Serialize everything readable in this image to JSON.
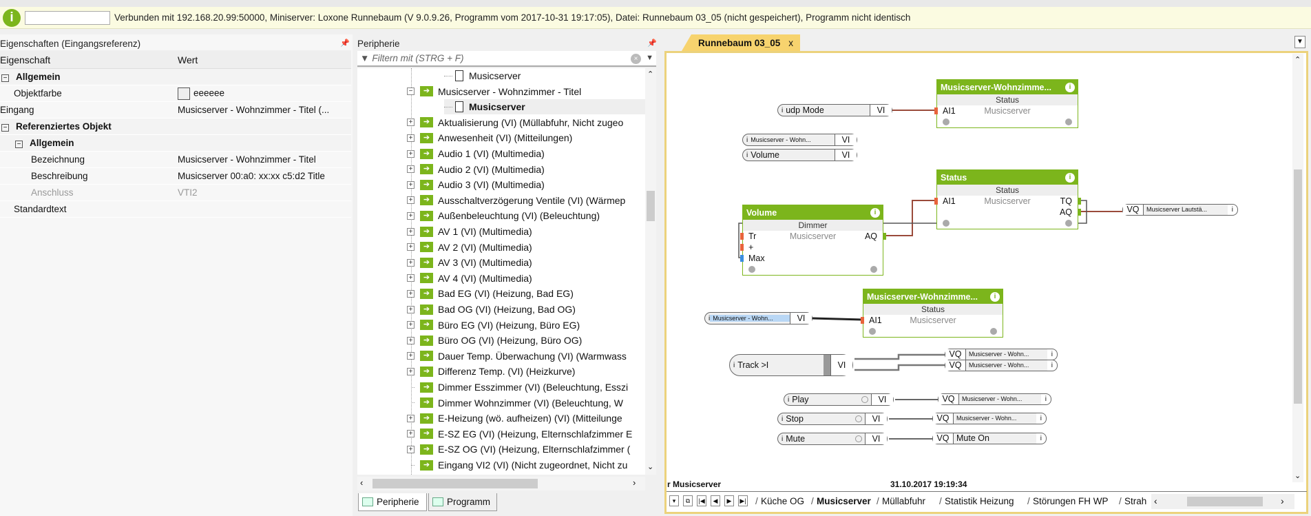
{
  "infobar": {
    "text": "Verbunden mit 192.168.20.99:50000, Miniserver: Loxone Runnebaum (V 9.0.9.26, Programm vom 2017-10-31 19:17:05), Datei: Runnebaum 03_05 (nicht gespeichert), Programm nicht identisch"
  },
  "properties": {
    "title": "Eigenschaften (Eingangsreferenz)",
    "col_property": "Eigenschaft",
    "col_value": "Wert",
    "rows": [
      {
        "label": "Allgemein",
        "value": "",
        "group": true,
        "level": 0
      },
      {
        "label": "Objektfarbe",
        "value": "eeeeee",
        "level": 1,
        "swatch": "#eeeeee"
      },
      {
        "label": "Eingang",
        "value": "Musicserver - Wohnzimmer - Titel (...",
        "level": 0
      },
      {
        "label": "Referenziertes Objekt",
        "value": "",
        "group": true,
        "level": 0
      },
      {
        "label": "Allgemein",
        "value": "",
        "group": true,
        "level": 1
      },
      {
        "label": "Bezeichnung",
        "value": "Musicserver - Wohnzimmer - Titel",
        "level": 2
      },
      {
        "label": "Beschreibung",
        "value": "Musicserver 00:a0: xx:xx c5:d2 Title",
        "level": 2
      },
      {
        "label": "Anschluss",
        "value": "VTI2",
        "level": 2,
        "dim": true
      },
      {
        "label": "Standardtext",
        "value": "",
        "level": 1
      }
    ]
  },
  "periphery": {
    "title": "Peripherie",
    "filter_placeholder": "Filtern mit (STRG + F)",
    "items": [
      {
        "label": "Musicserver",
        "kind": "doc"
      },
      {
        "label": "Musicserver - Wohnzimmer - Titel",
        "kind": "expanded"
      },
      {
        "label": "Musicserver",
        "kind": "doc",
        "selected": true
      },
      {
        "label": "Aktualisierung (VI) (Müllabfuhr, Nicht zugeo",
        "kind": "plus"
      },
      {
        "label": "Anwesenheit (VI) (Mitteilungen)",
        "kind": "plus"
      },
      {
        "label": "Audio 1 (VI) (Multimedia)",
        "kind": "plus"
      },
      {
        "label": "Audio 2 (VI) (Multimedia)",
        "kind": "plus"
      },
      {
        "label": "Audio 3 (VI) (Multimedia)",
        "kind": "plus"
      },
      {
        "label": "Ausschaltverzögerung Ventile (VI) (Wärmep",
        "kind": "plus"
      },
      {
        "label": "Außenbeleuchtung (VI) (Beleuchtung)",
        "kind": "plus"
      },
      {
        "label": "AV 1 (VI) (Multimedia)",
        "kind": "plus"
      },
      {
        "label": "AV 2 (VI) (Multimedia)",
        "kind": "plus"
      },
      {
        "label": "AV 3 (VI) (Multimedia)",
        "kind": "plus"
      },
      {
        "label": "AV 4 (VI) (Multimedia)",
        "kind": "plus"
      },
      {
        "label": "Bad EG (VI) (Heizung, Bad EG)",
        "kind": "plus"
      },
      {
        "label": "Bad OG (VI) (Heizung, Bad OG)",
        "kind": "plus"
      },
      {
        "label": "Büro EG (VI) (Heizung, Büro EG)",
        "kind": "plus"
      },
      {
        "label": "Büro OG (VI) (Heizung, Büro OG)",
        "kind": "plus"
      },
      {
        "label": "Dauer Temp. Überwachung (VI) (Warmwass",
        "kind": "plus"
      },
      {
        "label": "Differenz Temp. (VI) (Heizkurve)",
        "kind": "plus"
      },
      {
        "label": "Dimmer Esszimmer (VI) (Beleuchtung, Esszi",
        "kind": "leaf"
      },
      {
        "label": "Dimmer Wohnzimmer (VI) (Beleuchtung, W",
        "kind": "leaf"
      },
      {
        "label": "E-Heizung (wö. aufheizen) (VI) (Mitteilunge",
        "kind": "plus"
      },
      {
        "label": "E-SZ EG (VI) (Heizung, Elternschlafzimmer E",
        "kind": "plus"
      },
      {
        "label": "E-SZ OG (VI) (Heizung, Elternschlafzimmer (",
        "kind": "plus"
      },
      {
        "label": "Eingang VI2 (VI) (Nicht zugeordnet, Nicht zu",
        "kind": "leaf"
      }
    ],
    "tabs": [
      {
        "label": "Peripherie",
        "active": true
      },
      {
        "label": "Programm"
      }
    ]
  },
  "document": {
    "tab_label": "Runnebaum 03_05",
    "close": "x",
    "status_left": "r Musicserver",
    "status_date": "31.10.2017 19:19:34",
    "sheets": [
      {
        "label": "Küche OG"
      },
      {
        "label": "Musicserver",
        "active": true
      },
      {
        "label": "Müllabfuhr"
      },
      {
        "label": "Statistik Heizung"
      },
      {
        "label": "Störungen FH WP"
      },
      {
        "label": "Strah"
      }
    ]
  },
  "diagram": {
    "blocks": [
      {
        "title": "Musicserver-Wohnzimme...",
        "type": "Status",
        "center": "Musicserver",
        "inputs": [
          "AI1"
        ],
        "outputs": []
      },
      {
        "title": "Status",
        "type": "Status",
        "center": "Musicserver",
        "inputs": [
          "AI1"
        ],
        "outputs": [
          "TQ",
          "AQ"
        ]
      },
      {
        "title": "Volume",
        "type": "Dimmer",
        "center": "Musicserver",
        "inputs": [
          "Tr",
          "+",
          "Max"
        ],
        "outputs": [
          "AQ"
        ]
      },
      {
        "title": "Musicserver-Wohnzimme...",
        "type": "Status",
        "center": "Musicserver",
        "inputs": [
          "AI1"
        ],
        "outputs": []
      }
    ],
    "inputs": [
      {
        "label": "udp Mode",
        "kind": "VI"
      },
      {
        "label": "Musicserver - Wohn...",
        "kind": "VI",
        "small": true
      },
      {
        "label": "Volume",
        "kind": "VI"
      },
      {
        "label": "Musicserver - Wohn...",
        "kind": "VI",
        "small": true,
        "highlight": true
      },
      {
        "label": "Track >I",
        "kind": "VI"
      },
      {
        "label": "Play",
        "kind": "VI"
      },
      {
        "label": "Stop",
        "kind": "VI"
      },
      {
        "label": "Mute",
        "kind": "VI"
      }
    ],
    "outputs": [
      {
        "label": "Musicserver Lautstä...",
        "kind": "VQ"
      },
      {
        "label": "Musicserver - Wohn...",
        "kind": "VQ"
      },
      {
        "label": "Musicserver - Wohn...",
        "kind": "VQ"
      },
      {
        "label": "Musicserver - Wohn...",
        "kind": "VQ"
      },
      {
        "label": "Musicserver - Wohn...",
        "kind": "VQ"
      },
      {
        "label": "Mute On",
        "kind": "VQ",
        "big": true
      }
    ]
  },
  "colors": {
    "accent": "#7cb51c",
    "tab": "#f7d36e",
    "wire": "#9a4a3a"
  }
}
